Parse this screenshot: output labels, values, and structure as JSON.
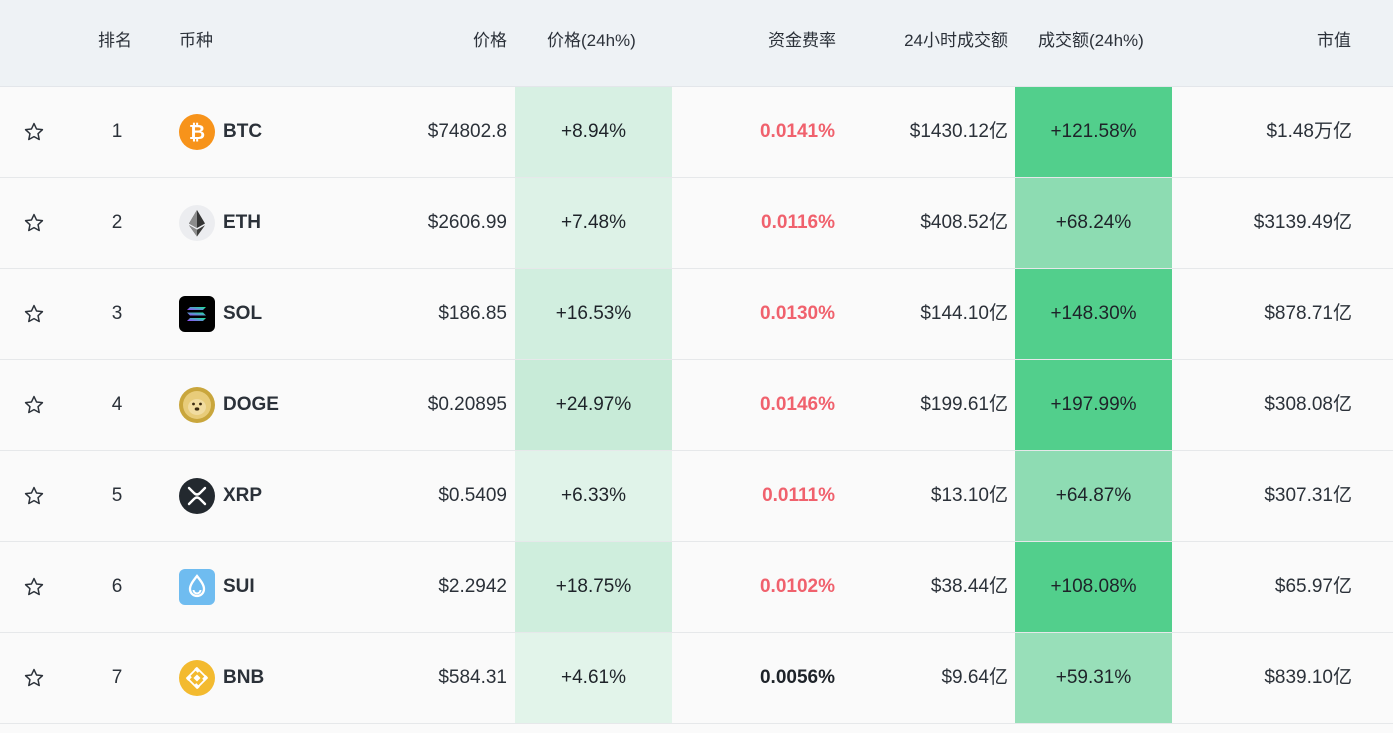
{
  "header": {
    "rank": "排名",
    "coin": "币种",
    "price": "价格",
    "price_change": "价格(24h%)",
    "funding_rate": "资金费率",
    "volume_24h": "24小时成交额",
    "volume_change": "成交额(24h%)",
    "market_cap": "市值"
  },
  "colors": {
    "funding_positive": "#f0616d",
    "funding_neutral": "#1e2329",
    "header_bg": "#eef2f5"
  },
  "rows": [
    {
      "rank": "1",
      "symbol": "BTC",
      "icon": "btc-icon",
      "price": "$74802.8",
      "price_change": "+8.94%",
      "price_change_bg": "#d7f0e3",
      "funding_rate": "0.0141%",
      "funding_color": "#f0616d",
      "volume": "$1430.12亿",
      "volume_change": "+121.58%",
      "volume_change_bg": "#52cf8c",
      "market_cap": "$1.48万亿"
    },
    {
      "rank": "2",
      "symbol": "ETH",
      "icon": "eth-icon",
      "price": "$2606.99",
      "price_change": "+7.48%",
      "price_change_bg": "#ddf2e7",
      "funding_rate": "0.0116%",
      "funding_color": "#f0616d",
      "volume": "$408.52亿",
      "volume_change": "+68.24%",
      "volume_change_bg": "#8ddcb2",
      "market_cap": "$3139.49亿"
    },
    {
      "rank": "3",
      "symbol": "SOL",
      "icon": "sol-icon",
      "price": "$186.85",
      "price_change": "+16.53%",
      "price_change_bg": "#d1eedf",
      "funding_rate": "0.0130%",
      "funding_color": "#f0616d",
      "volume": "$144.10亿",
      "volume_change": "+148.30%",
      "volume_change_bg": "#52cf8c",
      "market_cap": "$878.71亿"
    },
    {
      "rank": "4",
      "symbol": "DOGE",
      "icon": "doge-icon",
      "price": "$0.20895",
      "price_change": "+24.97%",
      "price_change_bg": "#c8ebd8",
      "funding_rate": "0.0146%",
      "funding_color": "#f0616d",
      "volume": "$199.61亿",
      "volume_change": "+197.99%",
      "volume_change_bg": "#52cf8c",
      "market_cap": "$308.08亿"
    },
    {
      "rank": "5",
      "symbol": "XRP",
      "icon": "xrp-icon",
      "price": "$0.5409",
      "price_change": "+6.33%",
      "price_change_bg": "#e0f3e9",
      "funding_rate": "0.0111%",
      "funding_color": "#f0616d",
      "volume": "$13.10亿",
      "volume_change": "+64.87%",
      "volume_change_bg": "#8edcb3",
      "market_cap": "$307.31亿"
    },
    {
      "rank": "6",
      "symbol": "SUI",
      "icon": "sui-icon",
      "price": "$2.2942",
      "price_change": "+18.75%",
      "price_change_bg": "#cfeedd",
      "funding_rate": "0.0102%",
      "funding_color": "#f0616d",
      "volume": "$38.44亿",
      "volume_change": "+108.08%",
      "volume_change_bg": "#52cf8c",
      "market_cap": "$65.97亿"
    },
    {
      "rank": "7",
      "symbol": "BNB",
      "icon": "bnb-icon",
      "price": "$584.31",
      "price_change": "+4.61%",
      "price_change_bg": "#e2f4ea",
      "funding_rate": "0.0056%",
      "funding_color": "#1e2329",
      "volume": "$9.64亿",
      "volume_change": "+59.31%",
      "volume_change_bg": "#98dfb9",
      "market_cap": "$839.10亿"
    }
  ]
}
